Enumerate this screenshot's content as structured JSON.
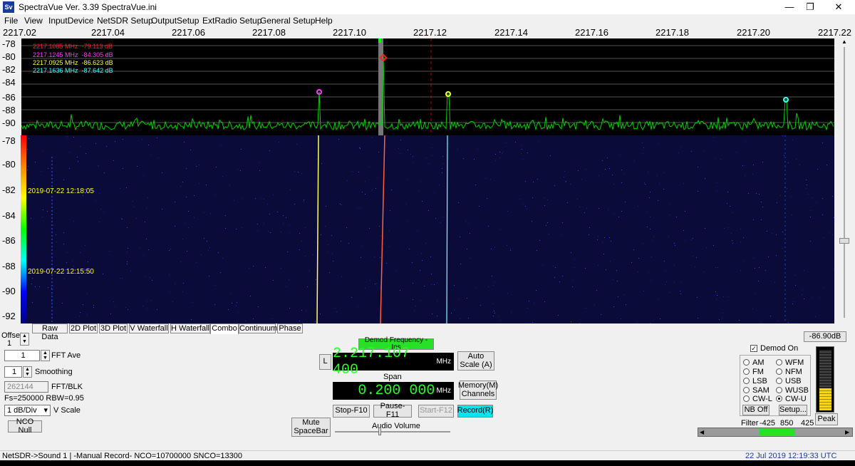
{
  "window": {
    "title": "SpectraVue Ver. 3.39  SpectraVue.ini",
    "app_icon": "Sv",
    "minimize": "—",
    "maximize": "❐",
    "close": "✕"
  },
  "menu": [
    "File",
    "View",
    "InputDevice",
    "NetSDR Setup",
    "OutputSetup",
    "ExtRadio Setup",
    "General Setup",
    "Help"
  ],
  "freq_axis": [
    "2217.02",
    "2217.04",
    "2217.06",
    "2217.08",
    "2217.10",
    "2217.12",
    "2217.14",
    "2217.16",
    "2217.18",
    "2217.20",
    "2217.22"
  ],
  "spectrum": {
    "y_labels": [
      "-78",
      "-80",
      "-82",
      "-84",
      "-86",
      "-88",
      "-90"
    ],
    "peaks": [
      {
        "freq": "2217.1085 MHz",
        "level": "-79.113 dB",
        "color": "#ff2020"
      },
      {
        "freq": "2217.1245 MHz",
        "level": "-84.305 dB",
        "color": "#ff40ff"
      },
      {
        "freq": "2217.0925 MHz",
        "level": "-86.623 dB",
        "color": "#ffff40"
      },
      {
        "freq": "2217.1636 MHz",
        "level": "-87.642 dB",
        "color": "#40ffff"
      }
    ]
  },
  "waterfall": {
    "y_labels": [
      "-78",
      "-80",
      "-82",
      "-84",
      "-86",
      "-88",
      "-90",
      "-92"
    ],
    "timestamps": [
      "2019-07-22 12:18:05",
      "2019-07-22 12:15:50"
    ]
  },
  "tabs": [
    "Raw Data",
    "2D Plot",
    "3D Plot",
    "V Waterfall",
    "H Waterfall",
    "Combo",
    "Continuum",
    "Phase"
  ],
  "active_tab": "Combo",
  "controls": {
    "offset_label": "Offset",
    "offset_value": "1",
    "fft_ave_value": "1",
    "fft_ave_label": "FFT Ave",
    "smoothing_value": "1",
    "smoothing_label": "Smoothing",
    "fft_blk_value": "262144",
    "fft_blk_label": "FFT/BLK",
    "fs_text": "Fs=250000 RBW=0.95",
    "vscale_value": "1 dB/Div",
    "vscale_label": "V Scale",
    "nco_null": "NCO Null",
    "mute": "Mute SpaceBar",
    "demod_freq_label": "Demod Frequency - Ins",
    "l_button": "L",
    "demod_freq": "2.217.107 400",
    "demod_unit": "MHz",
    "span_label": "Span",
    "span_value": "0.200 000",
    "span_unit": "MHz",
    "auto_scale": "Auto Scale (A)",
    "memory": "Memory(M) Channels",
    "stop": "Stop-F10",
    "pause": "Pause-F11",
    "start": "Start-F12",
    "record": "Record(R)",
    "audio_volume": "Audio Volume"
  },
  "demod": {
    "level": "-86.90dB",
    "demod_on": "Demod On",
    "modes": [
      "AM",
      "WFM",
      "FM",
      "NFM",
      "LSB",
      "USB",
      "SAM",
      "WUSB",
      "CW-L",
      "CW-U"
    ],
    "selected": "CW-U",
    "nb_off": "NB Off",
    "setup": "Setup...",
    "filter_label": "Filter",
    "filter_values": [
      "-425",
      "850",
      "425"
    ],
    "peak": "Peak"
  },
  "status": {
    "left": "NetSDR->Sound 1  | -Manual Record-   NCO=10700000  SNCO=13300",
    "right": "22 Jul 2019  12:19:33 UTC"
  }
}
